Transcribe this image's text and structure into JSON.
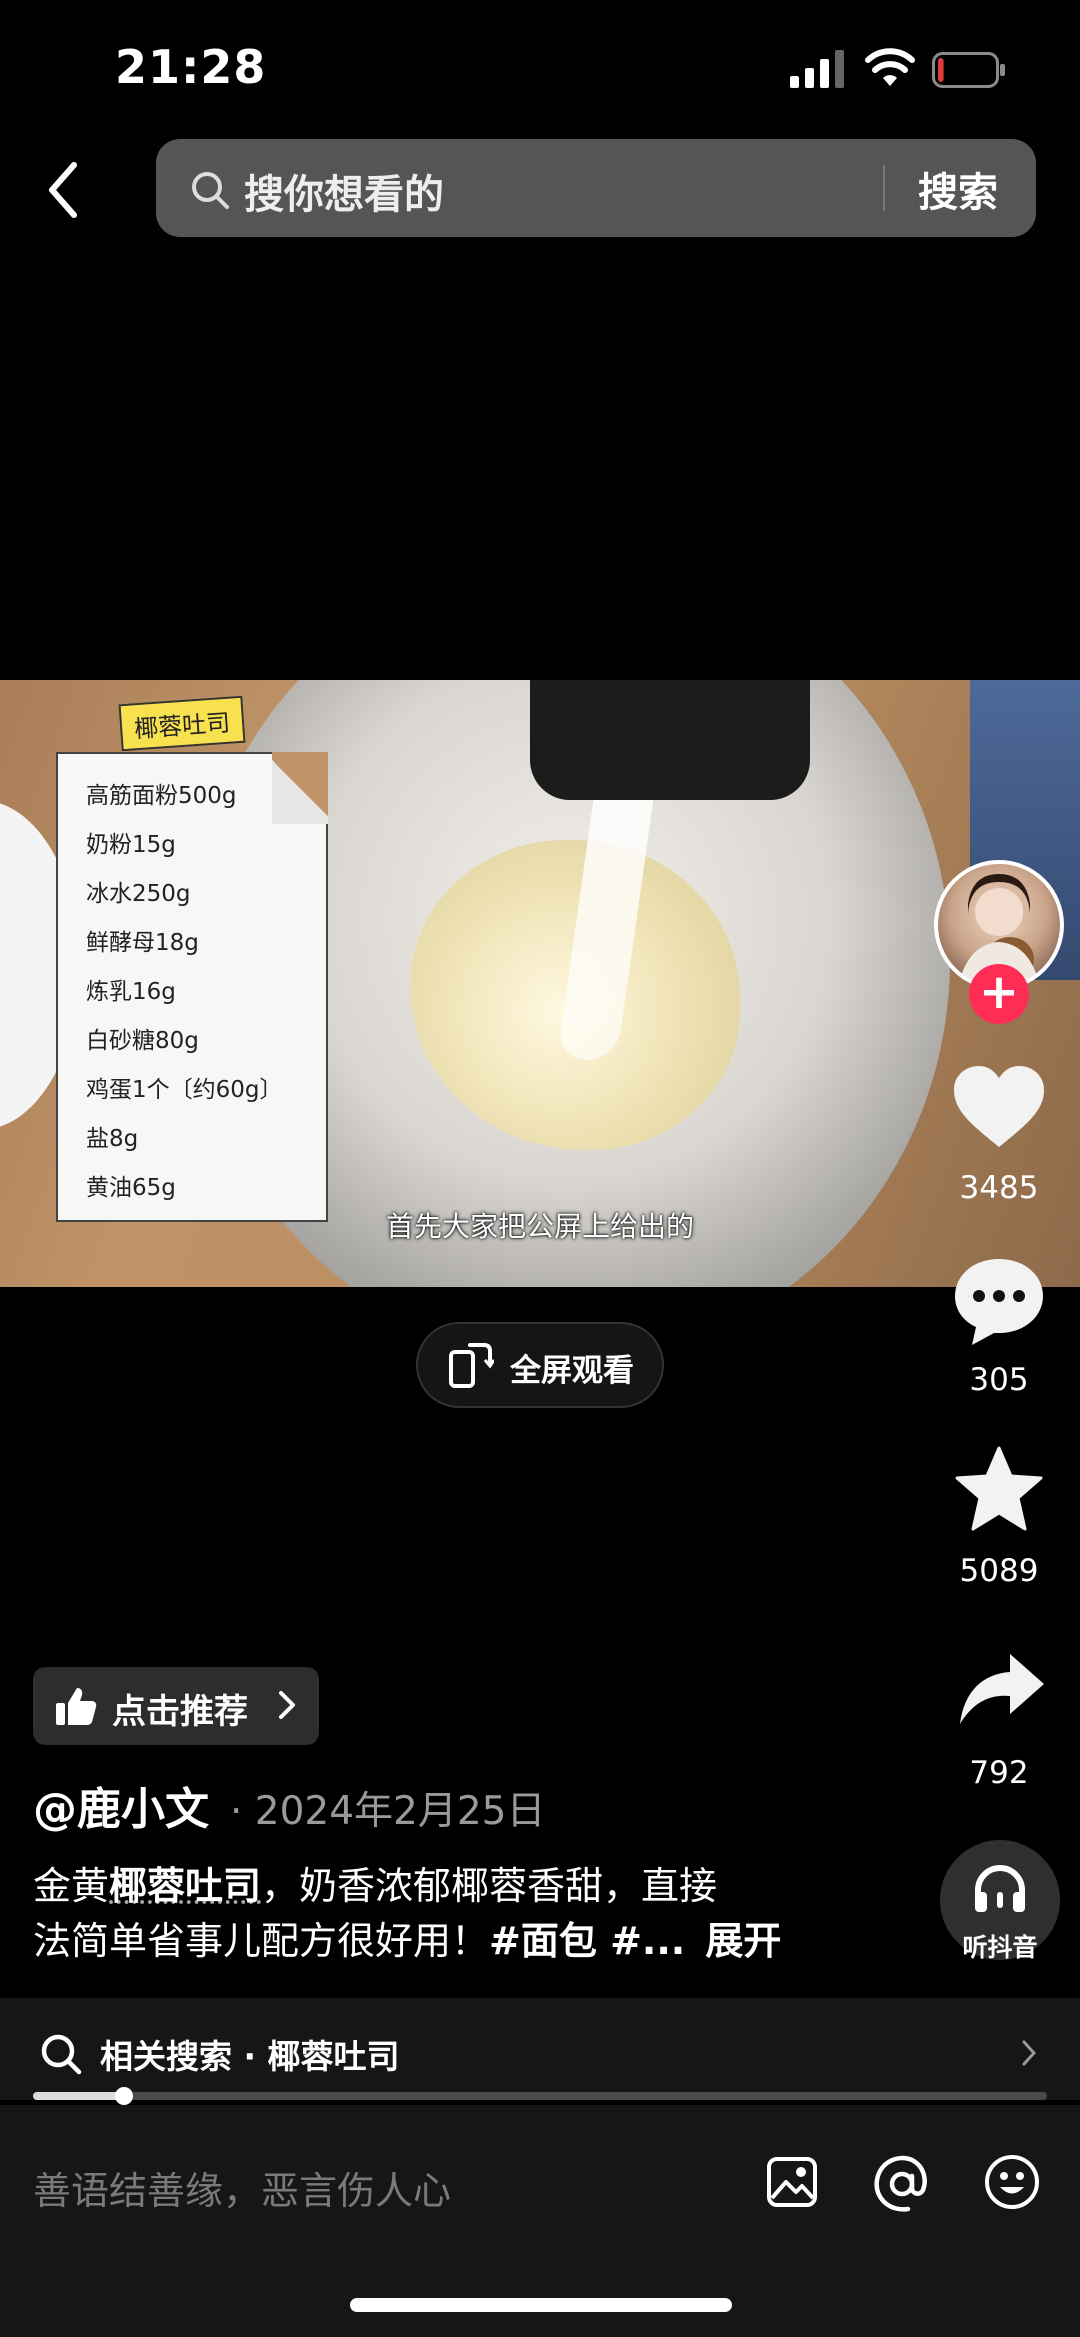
{
  "status_bar": {
    "time": "21:28",
    "battery_level": 0.1,
    "battery_color": "#e23b3b"
  },
  "top_bar": {
    "search_placeholder": "搜你想看的",
    "search_button": "搜索"
  },
  "video": {
    "recipe_tag": "椰蓉吐司",
    "ingredients": [
      "高筋面粉500g",
      "奶粉15g",
      "冰水250g",
      "鲜酵母18g",
      "炼乳16g",
      "白砂糖80g",
      "鸡蛋1个〔约60g〕",
      "盐8g",
      "黄油65g"
    ],
    "subtitle": "首先大家把公屏上给出的"
  },
  "fullscreen": {
    "label": "全屏观看"
  },
  "actions": {
    "likes": "3485",
    "comments": "305",
    "favorites": "5089",
    "shares": "792",
    "listen_label": "听抖音",
    "follow_symbol": "+",
    "accent_color": "#ff2c55"
  },
  "recommend": {
    "label": "点击推荐"
  },
  "post": {
    "author": "@鹿小文",
    "date": "· 2024年2月25日",
    "desc_line1_prefix": "金黄",
    "desc_line1_keyword": "椰蓉吐司",
    "desc_line1_suffix": "，奶香浓郁椰蓉香甜，直接",
    "desc_line2_text": "法简单省事儿配方很好用！",
    "desc_line2_tags": "#面包 #...",
    "expand": "展开"
  },
  "related_search": {
    "label": "相关搜索 · 椰蓉吐司",
    "progress": 0.09
  },
  "comment_bar": {
    "placeholder": "善语结善缘，恶言伤人心"
  }
}
